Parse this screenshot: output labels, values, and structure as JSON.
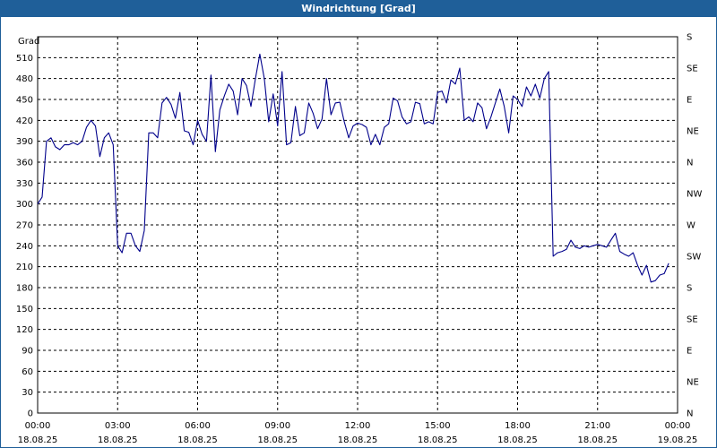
{
  "window": {
    "title": "Windrichtung [Grad]"
  },
  "chart_data": {
    "type": "line",
    "title": "Windrichtung [Grad]",
    "ylabel": "Grad",
    "ylim": [
      0,
      540
    ],
    "xlim": [
      "2025-08-18T00:00",
      "2025-08-19T00:00"
    ],
    "grid": true,
    "y_ticks": [
      0,
      30,
      60,
      90,
      120,
      150,
      180,
      210,
      240,
      270,
      300,
      330,
      360,
      390,
      420,
      450,
      480,
      510
    ],
    "y2_ticks": [
      "N",
      "NE",
      "E",
      "SE",
      "S",
      "SW",
      "W",
      "NW",
      "N",
      "NE",
      "E",
      "SE",
      "S"
    ],
    "x_ticks": [
      {
        "time": "00:00",
        "date": "18.08.25"
      },
      {
        "time": "03:00",
        "date": "18.08.25"
      },
      {
        "time": "06:00",
        "date": "18.08.25"
      },
      {
        "time": "09:00",
        "date": "18.08.25"
      },
      {
        "time": "12:00",
        "date": "18.08.25"
      },
      {
        "time": "15:00",
        "date": "18.08.25"
      },
      {
        "time": "18:00",
        "date": "18.08.25"
      },
      {
        "time": "21:00",
        "date": "18.08.25"
      },
      {
        "time": "00:00",
        "date": "19.08.25"
      }
    ],
    "series": [
      {
        "color": "#00008b",
        "points": [
          [
            "00:00",
            300
          ],
          [
            "00:10",
            310
          ],
          [
            "00:20",
            390
          ],
          [
            "00:30",
            395
          ],
          [
            "00:40",
            382
          ],
          [
            "00:50",
            378
          ],
          [
            "01:00",
            385
          ],
          [
            "01:10",
            385
          ],
          [
            "01:20",
            388
          ],
          [
            "01:30",
            385
          ],
          [
            "01:40",
            390
          ],
          [
            "01:50",
            410
          ],
          [
            "02:00",
            420
          ],
          [
            "02:10",
            412
          ],
          [
            "02:20",
            368
          ],
          [
            "02:30",
            395
          ],
          [
            "02:40",
            402
          ],
          [
            "02:50",
            385
          ],
          [
            "03:00",
            240
          ],
          [
            "03:10",
            230
          ],
          [
            "03:20",
            258
          ],
          [
            "03:30",
            258
          ],
          [
            "03:40",
            240
          ],
          [
            "03:50",
            232
          ],
          [
            "04:00",
            262
          ],
          [
            "04:10",
            402
          ],
          [
            "04:20",
            402
          ],
          [
            "04:30",
            395
          ],
          [
            "04:40",
            445
          ],
          [
            "04:50",
            453
          ],
          [
            "05:00",
            443
          ],
          [
            "05:10",
            423
          ],
          [
            "05:20",
            460
          ],
          [
            "05:30",
            405
          ],
          [
            "05:40",
            403
          ],
          [
            "05:50",
            385
          ],
          [
            "06:00",
            420
          ],
          [
            "06:10",
            400
          ],
          [
            "06:20",
            390
          ],
          [
            "06:30",
            485
          ],
          [
            "06:40",
            375
          ],
          [
            "06:50",
            435
          ],
          [
            "07:00",
            455
          ],
          [
            "07:10",
            472
          ],
          [
            "07:20",
            462
          ],
          [
            "07:30",
            428
          ],
          [
            "07:40",
            480
          ],
          [
            "07:50",
            470
          ],
          [
            "08:00",
            440
          ],
          [
            "08:10",
            480
          ],
          [
            "08:20",
            515
          ],
          [
            "08:30",
            480
          ],
          [
            "08:40",
            418
          ],
          [
            "08:50",
            458
          ],
          [
            "09:00",
            412
          ],
          [
            "09:10",
            490
          ],
          [
            "09:20",
            385
          ],
          [
            "09:30",
            388
          ],
          [
            "09:40",
            440
          ],
          [
            "09:50",
            398
          ],
          [
            "10:00",
            402
          ],
          [
            "10:10",
            445
          ],
          [
            "10:20",
            430
          ],
          [
            "10:30",
            408
          ],
          [
            "10:40",
            422
          ],
          [
            "10:50",
            480
          ],
          [
            "11:00",
            428
          ],
          [
            "11:10",
            445
          ],
          [
            "11:20",
            446
          ],
          [
            "11:30",
            418
          ],
          [
            "11:40",
            395
          ],
          [
            "11:50",
            412
          ],
          [
            "12:00",
            416
          ],
          [
            "12:10",
            414
          ],
          [
            "12:20",
            410
          ],
          [
            "12:30",
            385
          ],
          [
            "12:40",
            400
          ],
          [
            "12:50",
            385
          ],
          [
            "13:00",
            410
          ],
          [
            "13:10",
            415
          ],
          [
            "13:20",
            452
          ],
          [
            "13:30",
            448
          ],
          [
            "13:40",
            425
          ],
          [
            "13:50",
            415
          ],
          [
            "14:00",
            418
          ],
          [
            "14:10",
            446
          ],
          [
            "14:20",
            444
          ],
          [
            "14:30",
            415
          ],
          [
            "14:40",
            418
          ],
          [
            "14:50",
            415
          ],
          [
            "15:00",
            460
          ],
          [
            "15:10",
            462
          ],
          [
            "15:20",
            445
          ],
          [
            "15:30",
            478
          ],
          [
            "15:40",
            472
          ],
          [
            "15:50",
            495
          ],
          [
            "16:00",
            420
          ],
          [
            "16:10",
            425
          ],
          [
            "16:20",
            418
          ],
          [
            "16:30",
            445
          ],
          [
            "16:40",
            438
          ],
          [
            "16:50",
            408
          ],
          [
            "17:00",
            425
          ],
          [
            "17:10",
            445
          ],
          [
            "17:20",
            465
          ],
          [
            "17:30",
            440
          ],
          [
            "17:40",
            402
          ],
          [
            "17:50",
            455
          ],
          [
            "18:00",
            450
          ],
          [
            "18:10",
            440
          ],
          [
            "18:20",
            468
          ],
          [
            "18:30",
            455
          ],
          [
            "18:40",
            472
          ],
          [
            "18:50",
            452
          ],
          [
            "19:00",
            480
          ],
          [
            "19:10",
            490
          ],
          [
            "19:20",
            225
          ],
          [
            "19:30",
            230
          ],
          [
            "19:40",
            232
          ],
          [
            "19:50",
            235
          ],
          [
            "20:00",
            248
          ],
          [
            "20:10",
            238
          ],
          [
            "20:20",
            236
          ],
          [
            "20:30",
            240
          ],
          [
            "20:40",
            238
          ],
          [
            "20:50",
            240
          ],
          [
            "21:00",
            242
          ],
          [
            "21:10",
            240
          ],
          [
            "21:20",
            238
          ],
          [
            "21:30",
            248
          ],
          [
            "21:40",
            258
          ],
          [
            "21:50",
            232
          ],
          [
            "22:00",
            228
          ],
          [
            "22:10",
            225
          ],
          [
            "22:20",
            230
          ],
          [
            "22:30",
            212
          ],
          [
            "22:40",
            198
          ],
          [
            "22:50",
            212
          ],
          [
            "23:00",
            188
          ],
          [
            "23:10",
            190
          ],
          [
            "23:20",
            198
          ],
          [
            "23:30",
            200
          ],
          [
            "23:40",
            215
          ]
        ]
      }
    ]
  }
}
